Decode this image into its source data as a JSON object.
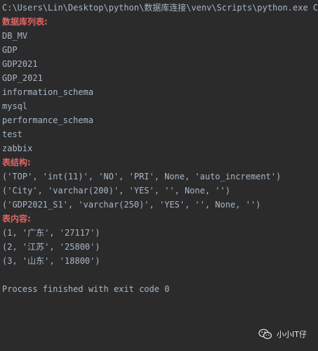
{
  "console": {
    "command": "C:\\Users\\Lin\\Desktop\\python\\数据库连接\\venv\\Scripts\\python.exe C:",
    "sections": {
      "databases_heading": "数据库列表:",
      "databases": [
        "DB_MV",
        "GDP",
        "GDP2021",
        "GDP_2021",
        "information_schema",
        "mysql",
        "performance_schema",
        "test",
        "zabbix"
      ],
      "structure_heading": "表结构:",
      "structure_rows": [
        "('TOP', 'int(11)', 'NO', 'PRI', None, 'auto_increment')",
        "('City', 'varchar(200)', 'YES', '', None, '')",
        "('GDP2021_S1', 'varchar(250)', 'YES', '', None, '')"
      ],
      "content_heading": "表内容:",
      "content_rows": [
        "(1, '广东', '27117')",
        "(2, '江苏', '25800')",
        "(3, '山东', '18800')"
      ]
    },
    "exit_message": "Process finished with exit code 0"
  },
  "watermark": {
    "icon": "wechat-icon",
    "label": "小小IT仔"
  },
  "colors": {
    "background": "#2b2b2b",
    "text": "#a9b7c6",
    "heading": "#e06666"
  }
}
